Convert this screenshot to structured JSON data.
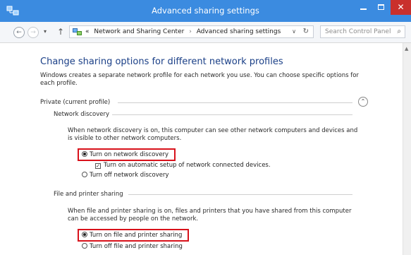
{
  "window": {
    "title": "Advanced sharing settings",
    "close_glyph": "✕"
  },
  "nav": {
    "back_glyph": "←",
    "forward_glyph": "→",
    "history_glyph": "▾",
    "up_glyph": "↑",
    "breadcrumb": {
      "prefix": "«",
      "items": [
        "Network and Sharing Center",
        "Advanced sharing settings"
      ],
      "separator": "›"
    },
    "dropdown_glyph": "∨",
    "refresh_glyph": "↻",
    "search": {
      "placeholder": "Search Control Panel",
      "icon_glyph": "⌕"
    }
  },
  "page": {
    "heading": "Change sharing options for different network profiles",
    "description": "Windows creates a separate network profile for each network you use. You can choose specific options for each profile.",
    "profile": {
      "label": "Private (current profile)",
      "collapse_glyph": "⌃"
    },
    "network_discovery": {
      "title": "Network discovery",
      "description": "When network discovery is on, this computer can see other network computers and devices and is visible to other network computers.",
      "options": [
        {
          "label": "Turn on network discovery",
          "selected": true
        },
        {
          "label": "Turn on automatic setup of network connected devices.",
          "checked": true
        },
        {
          "label": "Turn off network discovery",
          "selected": false
        }
      ]
    },
    "file_printer_sharing": {
      "title": "File and printer sharing",
      "description": "When file and printer sharing is on, files and printers that you have shared from this computer can be accessed by people on the network.",
      "options": [
        {
          "label": "Turn on file and printer sharing",
          "selected": true
        },
        {
          "label": "Turn off file and printer sharing",
          "selected": false
        }
      ]
    }
  },
  "colors": {
    "titlebar": "#3b8be0",
    "heading": "#1a3f87",
    "highlight": "#d8121b",
    "close_button": "#c9302c"
  }
}
